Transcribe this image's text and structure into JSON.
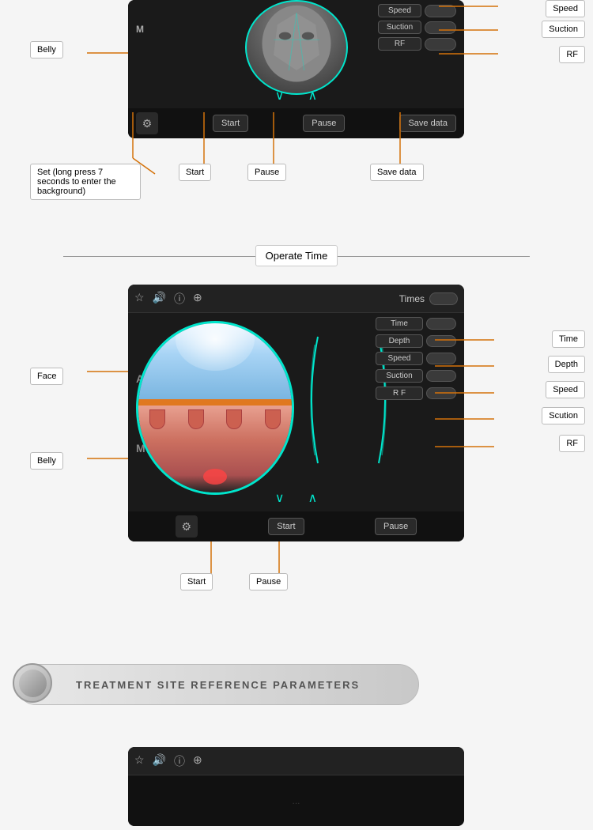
{
  "top_section": {
    "panel": {
      "controls": [
        {
          "label": "Speed",
          "toggle": ""
        },
        {
          "label": "Suction",
          "toggle": ""
        },
        {
          "label": "RF",
          "toggle": ""
        }
      ],
      "bottom_bar": {
        "gear_icon": "⚙",
        "start_label": "Start",
        "pause_label": "Pause",
        "save_label": "Save data"
      },
      "indicator_m": "M",
      "arrow_down": "∨",
      "arrow_up": "∧"
    },
    "callouts": {
      "belly": "Belly",
      "set_label": "Set (long press 7 seconds to enter the background)",
      "start": "Start",
      "pause": "Pause",
      "save_data": "Save data"
    },
    "right_callouts": {
      "speed": "Speed",
      "suction": "Suction",
      "rf": "RF"
    }
  },
  "operate_time_section": {
    "label": "Operate Time",
    "panel": {
      "icons": [
        "☆",
        "🔊",
        "ⓘ",
        "⊕"
      ],
      "times_label": "Times",
      "controls": [
        {
          "label": "Time"
        },
        {
          "label": "Depth"
        },
        {
          "label": "Speed"
        },
        {
          "label": "Suction"
        },
        {
          "label": "R F"
        }
      ],
      "indicator_a": "A",
      "indicator_m": "M",
      "arrow_down": "∨",
      "arrow_up": "∧",
      "bottom_bar": {
        "gear_icon": "⚙",
        "start_label": "Start",
        "pause_label": "Pause"
      }
    },
    "callouts": {
      "face": "Face",
      "belly": "Belly",
      "start": "Start",
      "pause": "Pause"
    },
    "right_callouts": {
      "time": "Time",
      "depth": "Depth",
      "speed": "Speed",
      "scution": "Scution",
      "rf": "RF"
    }
  },
  "treatment_section": {
    "label": "TREATMENT SITE REFERENCE PARAMETERS"
  }
}
